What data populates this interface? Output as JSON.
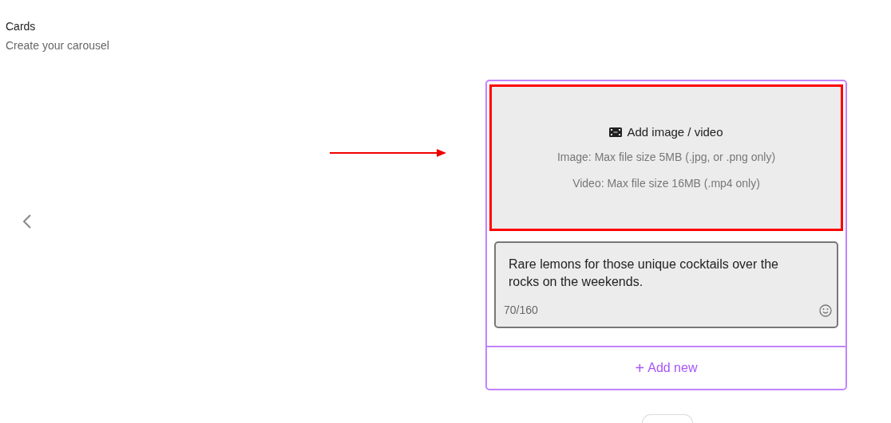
{
  "header": {
    "title": "Cards",
    "subtitle": "Create your carousel"
  },
  "card": {
    "media": {
      "label": "Add image / video",
      "hints": [
        "Image: Max file size 5MB (.jpg, or .png only)",
        "Video: Max file size 16MB (.mp4 only)"
      ],
      "highlighted": true
    },
    "text": {
      "value": "Rare lemons for those unique cocktails over the rocks on the weekends.",
      "counter": "70/160"
    },
    "add_button": {
      "icon": "+",
      "label": "Add new"
    }
  },
  "annotation_arrow": true
}
